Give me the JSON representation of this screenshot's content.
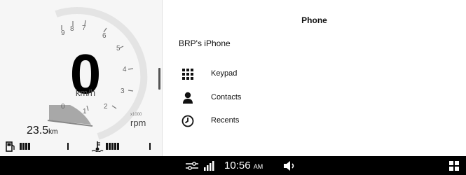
{
  "gauge": {
    "speed_value": "0",
    "speed_unit": "km/h",
    "rpm_multiplier": "x1000",
    "rpm_unit": "rpm",
    "tach_labels": [
      "0",
      "1",
      "2",
      "3",
      "4",
      "5",
      "6",
      "7",
      "8",
      "9"
    ],
    "odometer_value": "23.5",
    "odometer_unit": "km",
    "fuel_level_bars": 4,
    "temp_level_bars": 5
  },
  "phone": {
    "title": "Phone",
    "device_name": "BRP's iPhone",
    "menu": [
      {
        "label": "Keypad",
        "icon": "keypad-icon"
      },
      {
        "label": "Contacts",
        "icon": "contact-icon"
      },
      {
        "label": "Recents",
        "icon": "clock-icon"
      }
    ]
  },
  "status_bar": {
    "time": "10:56",
    "ampm": "AM",
    "icons": [
      "settings-sliders-icon",
      "signal-icon",
      "volume-icon",
      "app-grid-icon"
    ]
  },
  "colors": {
    "accent_dark": "#000000",
    "gauge_bg": "#f6f6f6",
    "redline_zone": "#b0b0b0"
  }
}
